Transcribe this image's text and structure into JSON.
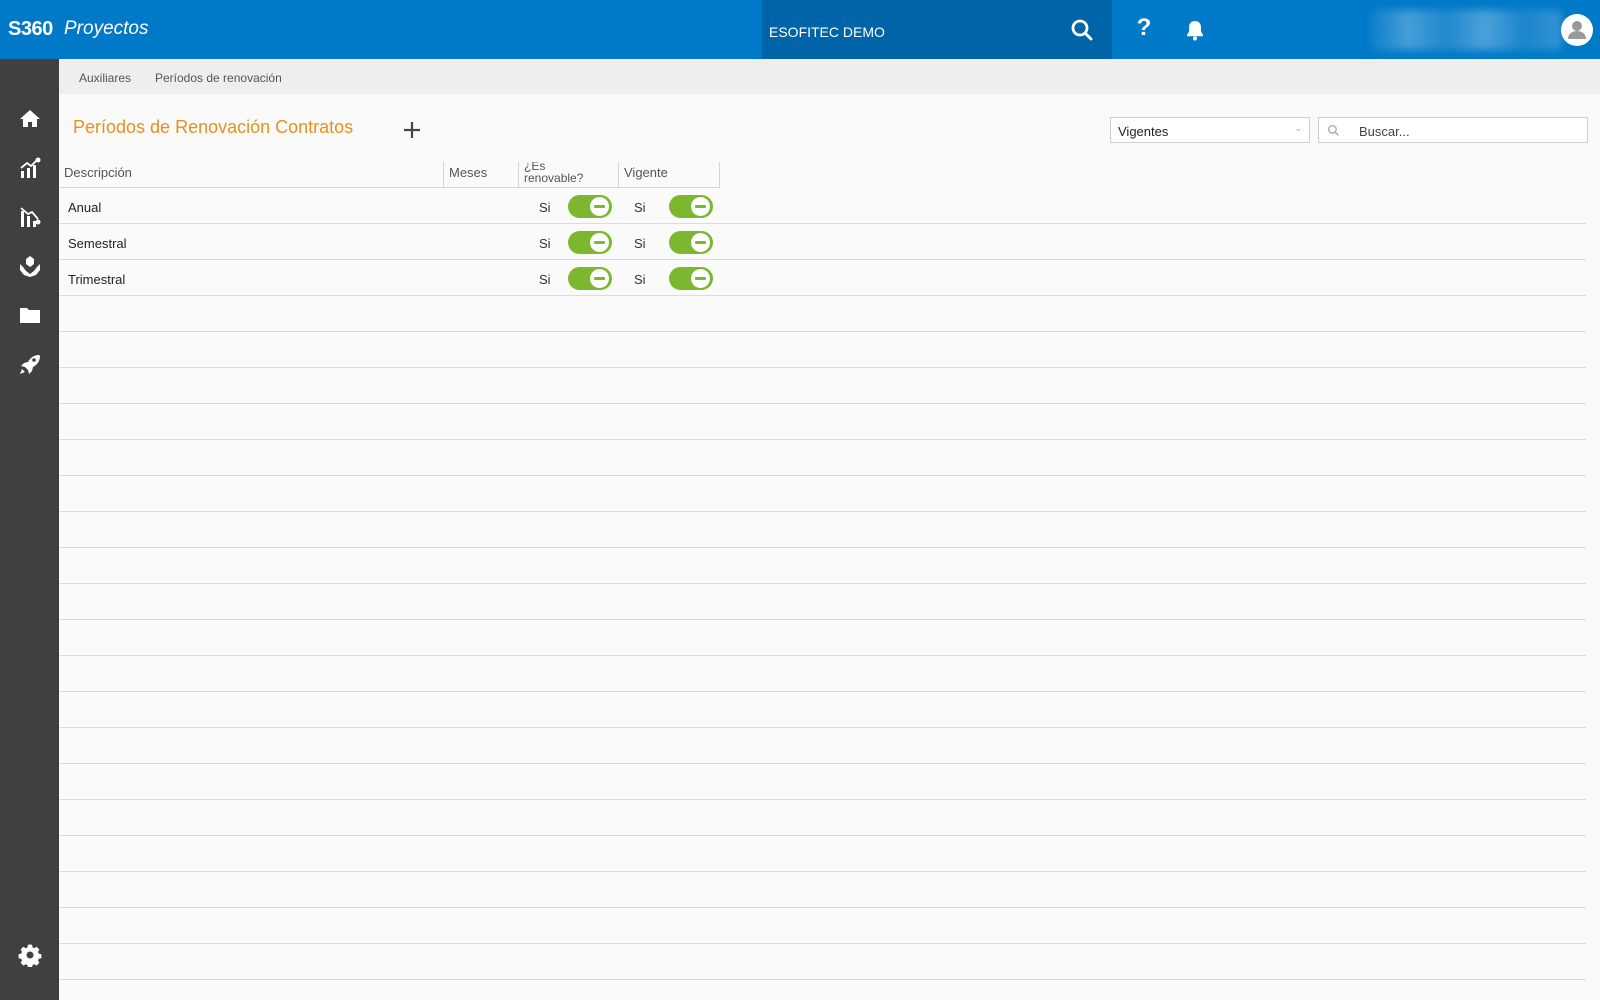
{
  "topbar": {
    "brand": "S360",
    "module": "Proyectos",
    "company": "ESOFITEC DEMO",
    "help_symbol": "?",
    "color": "#0079c8"
  },
  "sidebar": {
    "items": [
      "home-icon",
      "chart-growth-icon",
      "chart-decline-icon",
      "hands-icon",
      "folder-icon",
      "rocket-icon"
    ],
    "bottom": "gear-icon"
  },
  "breadcrumb": [
    "Auxiliares",
    "Períodos de renovación"
  ],
  "page": {
    "title": "Períodos de Renovación Contratos",
    "add_symbol": "+",
    "filter_value": "Vigentes",
    "search_placeholder": "Buscar..."
  },
  "table": {
    "columns": [
      "Descripción",
      "Meses",
      "¿Es renovable?",
      "Vigente"
    ],
    "rows": [
      {
        "descripcion": "Anual",
        "meses": "",
        "renovable": "Si",
        "vigente": "Si"
      },
      {
        "descripcion": "Semestral",
        "meses": "",
        "renovable": "Si",
        "vigente": "Si"
      },
      {
        "descripcion": "Trimestral",
        "meses": "",
        "renovable": "Si",
        "vigente": "Si"
      }
    ],
    "toggle_color": "#7cb82f"
  },
  "accent_color": "#e8901c"
}
